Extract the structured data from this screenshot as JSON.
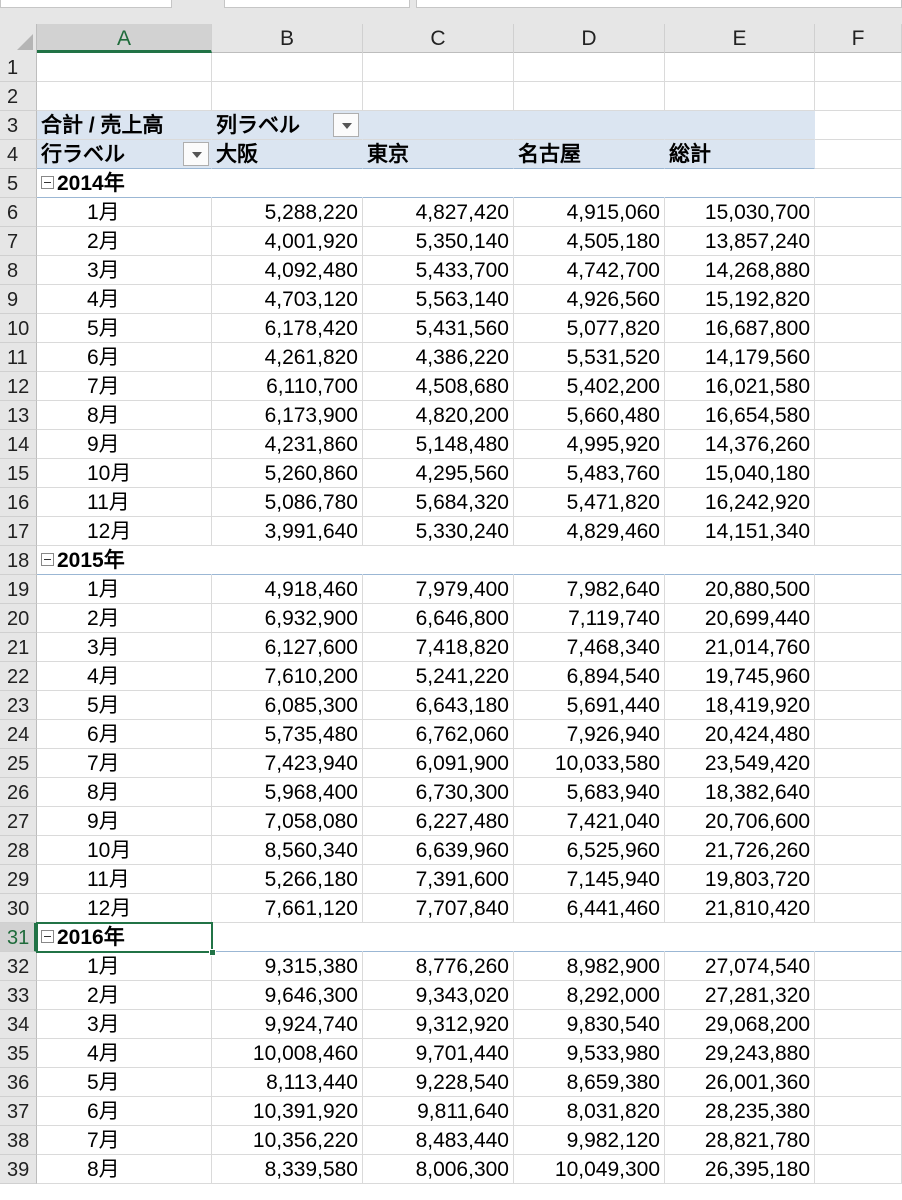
{
  "columns": [
    "A",
    "B",
    "C",
    "D",
    "E",
    "F"
  ],
  "active_column": "A",
  "active_row": 31,
  "rows": [
    {
      "n": "1",
      "kind": "blank"
    },
    {
      "n": "2",
      "kind": "blank"
    },
    {
      "n": "3",
      "kind": "pivot-top",
      "a": "合計 / 売上高",
      "b": "列ラベル"
    },
    {
      "n": "4",
      "kind": "pivot-cols",
      "a": "行ラベル",
      "b": "大阪",
      "c": "東京",
      "d": "名古屋",
      "e": "総計"
    },
    {
      "n": "5",
      "kind": "year",
      "a": "2014年"
    },
    {
      "n": "6",
      "kind": "data",
      "a": "1月",
      "b": "5,288,220",
      "c": "4,827,420",
      "d": "4,915,060",
      "e": "15,030,700"
    },
    {
      "n": "7",
      "kind": "data",
      "a": "2月",
      "b": "4,001,920",
      "c": "5,350,140",
      "d": "4,505,180",
      "e": "13,857,240"
    },
    {
      "n": "8",
      "kind": "data",
      "a": "3月",
      "b": "4,092,480",
      "c": "5,433,700",
      "d": "4,742,700",
      "e": "14,268,880"
    },
    {
      "n": "9",
      "kind": "data",
      "a": "4月",
      "b": "4,703,120",
      "c": "5,563,140",
      "d": "4,926,560",
      "e": "15,192,820"
    },
    {
      "n": "10",
      "kind": "data",
      "a": "5月",
      "b": "6,178,420",
      "c": "5,431,560",
      "d": "5,077,820",
      "e": "16,687,800"
    },
    {
      "n": "11",
      "kind": "data",
      "a": "6月",
      "b": "4,261,820",
      "c": "4,386,220",
      "d": "5,531,520",
      "e": "14,179,560"
    },
    {
      "n": "12",
      "kind": "data",
      "a": "7月",
      "b": "6,110,700",
      "c": "4,508,680",
      "d": "5,402,200",
      "e": "16,021,580"
    },
    {
      "n": "13",
      "kind": "data",
      "a": "8月",
      "b": "6,173,900",
      "c": "4,820,200",
      "d": "5,660,480",
      "e": "16,654,580"
    },
    {
      "n": "14",
      "kind": "data",
      "a": "9月",
      "b": "4,231,860",
      "c": "5,148,480",
      "d": "4,995,920",
      "e": "14,376,260"
    },
    {
      "n": "15",
      "kind": "data",
      "a": "10月",
      "b": "5,260,860",
      "c": "4,295,560",
      "d": "5,483,760",
      "e": "15,040,180"
    },
    {
      "n": "16",
      "kind": "data",
      "a": "11月",
      "b": "5,086,780",
      "c": "5,684,320",
      "d": "5,471,820",
      "e": "16,242,920"
    },
    {
      "n": "17",
      "kind": "data",
      "a": "12月",
      "b": "3,991,640",
      "c": "5,330,240",
      "d": "4,829,460",
      "e": "14,151,340"
    },
    {
      "n": "18",
      "kind": "year",
      "a": "2015年"
    },
    {
      "n": "19",
      "kind": "data",
      "a": "1月",
      "b": "4,918,460",
      "c": "7,979,400",
      "d": "7,982,640",
      "e": "20,880,500"
    },
    {
      "n": "20",
      "kind": "data",
      "a": "2月",
      "b": "6,932,900",
      "c": "6,646,800",
      "d": "7,119,740",
      "e": "20,699,440"
    },
    {
      "n": "21",
      "kind": "data",
      "a": "3月",
      "b": "6,127,600",
      "c": "7,418,820",
      "d": "7,468,340",
      "e": "21,014,760"
    },
    {
      "n": "22",
      "kind": "data",
      "a": "4月",
      "b": "7,610,200",
      "c": "5,241,220",
      "d": "6,894,540",
      "e": "19,745,960"
    },
    {
      "n": "23",
      "kind": "data",
      "a": "5月",
      "b": "6,085,300",
      "c": "6,643,180",
      "d": "5,691,440",
      "e": "18,419,920"
    },
    {
      "n": "24",
      "kind": "data",
      "a": "6月",
      "b": "5,735,480",
      "c": "6,762,060",
      "d": "7,926,940",
      "e": "20,424,480"
    },
    {
      "n": "25",
      "kind": "data",
      "a": "7月",
      "b": "7,423,940",
      "c": "6,091,900",
      "d": "10,033,580",
      "e": "23,549,420"
    },
    {
      "n": "26",
      "kind": "data",
      "a": "8月",
      "b": "5,968,400",
      "c": "6,730,300",
      "d": "5,683,940",
      "e": "18,382,640"
    },
    {
      "n": "27",
      "kind": "data",
      "a": "9月",
      "b": "7,058,080",
      "c": "6,227,480",
      "d": "7,421,040",
      "e": "20,706,600"
    },
    {
      "n": "28",
      "kind": "data",
      "a": "10月",
      "b": "8,560,340",
      "c": "6,639,960",
      "d": "6,525,960",
      "e": "21,726,260"
    },
    {
      "n": "29",
      "kind": "data",
      "a": "11月",
      "b": "5,266,180",
      "c": "7,391,600",
      "d": "7,145,940",
      "e": "19,803,720"
    },
    {
      "n": "30",
      "kind": "data",
      "a": "12月",
      "b": "7,661,120",
      "c": "7,707,840",
      "d": "6,441,460",
      "e": "21,810,420"
    },
    {
      "n": "31",
      "kind": "year",
      "a": "2016年"
    },
    {
      "n": "32",
      "kind": "data",
      "a": "1月",
      "b": "9,315,380",
      "c": "8,776,260",
      "d": "8,982,900",
      "e": "27,074,540"
    },
    {
      "n": "33",
      "kind": "data",
      "a": "2月",
      "b": "9,646,300",
      "c": "9,343,020",
      "d": "8,292,000",
      "e": "27,281,320"
    },
    {
      "n": "34",
      "kind": "data",
      "a": "3月",
      "b": "9,924,740",
      "c": "9,312,920",
      "d": "9,830,540",
      "e": "29,068,200"
    },
    {
      "n": "35",
      "kind": "data",
      "a": "4月",
      "b": "10,008,460",
      "c": "9,701,440",
      "d": "9,533,980",
      "e": "29,243,880"
    },
    {
      "n": "36",
      "kind": "data",
      "a": "5月",
      "b": "8,113,440",
      "c": "9,228,540",
      "d": "8,659,380",
      "e": "26,001,360"
    },
    {
      "n": "37",
      "kind": "data",
      "a": "6月",
      "b": "10,391,920",
      "c": "9,811,640",
      "d": "8,031,820",
      "e": "28,235,380"
    },
    {
      "n": "38",
      "kind": "data",
      "a": "7月",
      "b": "10,356,220",
      "c": "8,483,440",
      "d": "9,982,120",
      "e": "28,821,780"
    },
    {
      "n": "39",
      "kind": "data",
      "a": "8月",
      "b": "8,339,580",
      "c": "8,006,300",
      "d": "10,049,300",
      "e": "26,395,180"
    }
  ],
  "colors": {
    "pivot_header_bg": "#dbe5f1",
    "selection": "#217346",
    "header_bg": "#e6e6e6"
  }
}
